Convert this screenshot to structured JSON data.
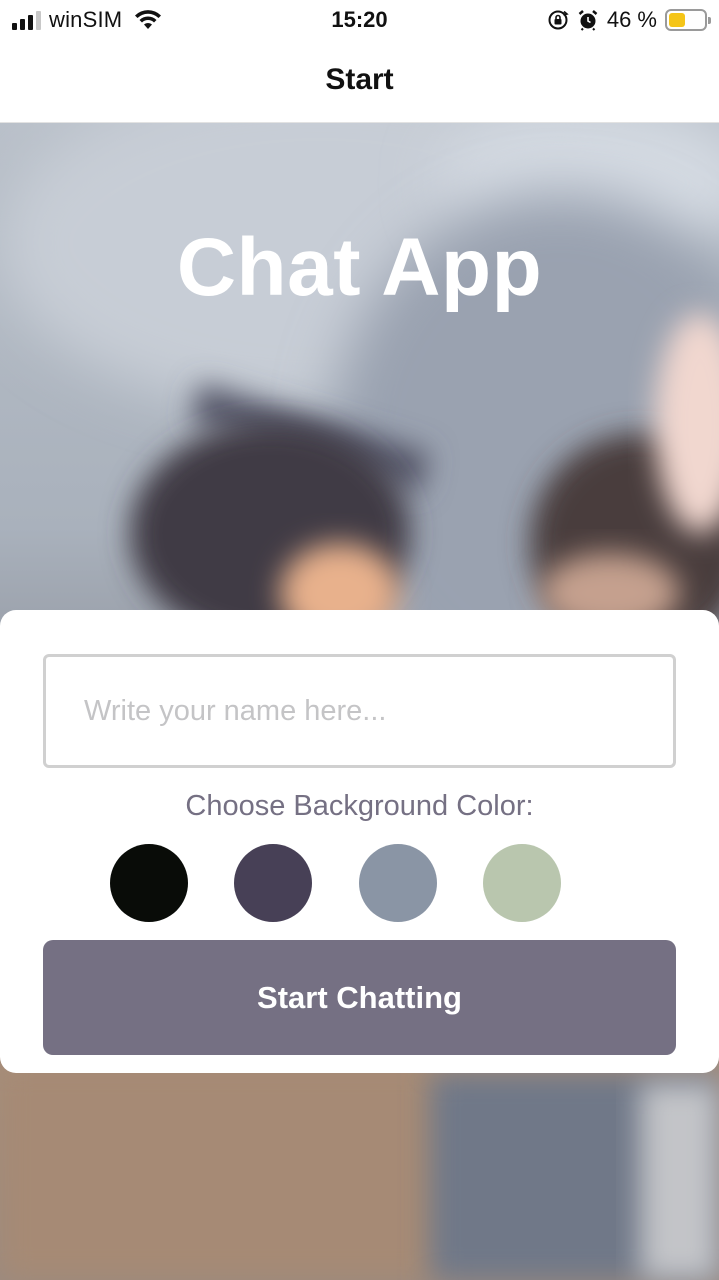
{
  "status_bar": {
    "carrier": "winSIM",
    "time": "15:20",
    "battery_percent": "46 %",
    "battery_level": 0.46,
    "icons": [
      "signal-icon",
      "wifi-icon",
      "rotation-lock-icon",
      "alarm-icon",
      "battery-icon"
    ]
  },
  "nav": {
    "title": "Start"
  },
  "hero": {
    "title": "Chat App"
  },
  "form": {
    "name_placeholder": "Write your name here...",
    "name_value": "",
    "color_label": "Choose Background Color:",
    "colors": [
      "#090C08",
      "#474056",
      "#8A95A5",
      "#B9C6AE"
    ],
    "button_label": "Start Chatting",
    "button_color": "#757083"
  },
  "theme": {
    "label_color": "#757083",
    "placeholder_color": "#c4c4c6",
    "battery_color": "#f5c518"
  }
}
